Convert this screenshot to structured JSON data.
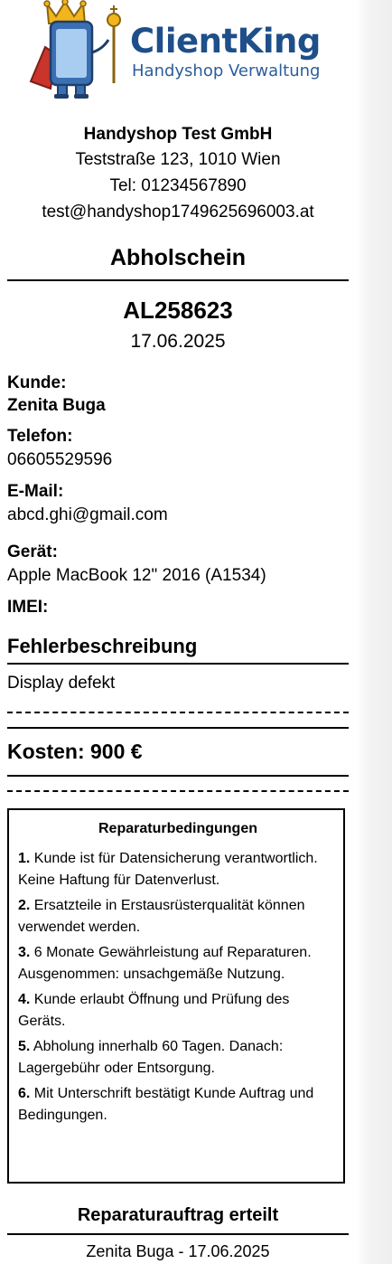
{
  "logo": {
    "brand": "ClientKing",
    "tagline": "Handyshop Verwaltung"
  },
  "shop": {
    "name": "Handyshop Test GmbH",
    "address": "Teststraße 123, 1010 Wien",
    "phone": "Tel: 01234567890",
    "email": "test@handyshop1749625696003.at"
  },
  "document": {
    "title": "Abholschein",
    "order_number": "AL258623",
    "date": "17.06.2025"
  },
  "customer": {
    "label": "Kunde:",
    "name": "Zenita Buga",
    "phone_label": "Telefon:",
    "phone": "06605529596",
    "email_label": "E-Mail:",
    "email": "abcd.ghi@gmail.com"
  },
  "device": {
    "label": "Gerät:",
    "name": "Apple MacBook 12\" 2016 (A1534)",
    "imei_label": "IMEI:",
    "imei": ""
  },
  "fault": {
    "heading": "Fehlerbeschreibung",
    "text": "Display defekt"
  },
  "cost": {
    "text": "Kosten: 900 €"
  },
  "terms": {
    "title": "Reparaturbedingungen",
    "items": [
      {
        "num": "1.",
        "text": " Kunde ist für Datensicherung verantwortlich. Keine Haftung für Datenverlust."
      },
      {
        "num": "2.",
        "text": " Ersatzteile in Erstausrüsterqualität können verwendet werden."
      },
      {
        "num": "3.",
        "text": " 6 Monate Gewährleistung auf Reparaturen. Ausgenommen: unsachgemäße Nutzung."
      },
      {
        "num": "4.",
        "text": " Kunde erlaubt Öffnung und Prüfung des Geräts."
      },
      {
        "num": "5.",
        "text": " Abholung innerhalb 60 Tagen. Danach: Lagergebühr oder Entsorgung."
      },
      {
        "num": "6.",
        "text": " Mit Unterschrift bestätigt Kunde Auftrag und Bedingungen."
      }
    ]
  },
  "signature": {
    "title": "Reparaturauftrag erteilt",
    "line": "Zenita Buga - 17.06.2025"
  },
  "colors": {
    "brand": "#1e4f8a",
    "crown": "#f2b51c",
    "phone_body": "#3b6fb3",
    "cape": "#c9352b"
  }
}
